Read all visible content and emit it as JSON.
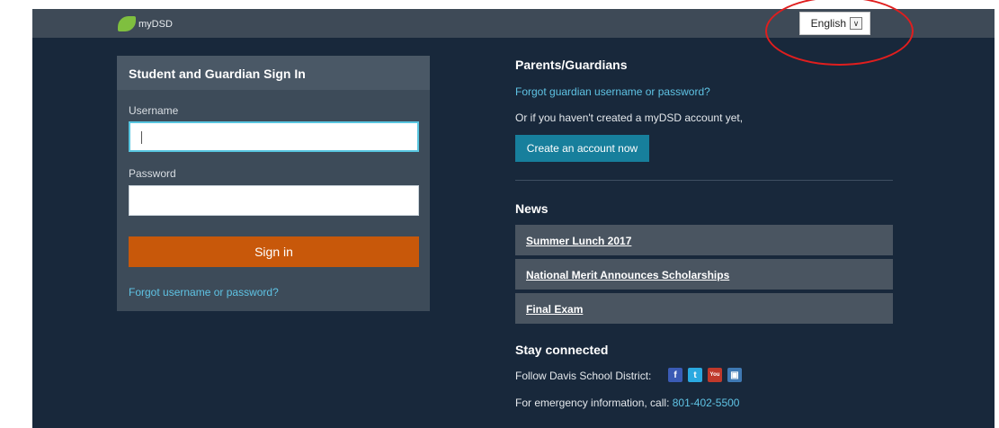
{
  "header": {
    "logo_text": "myDSD",
    "language": "English",
    "language_dropdown_icon": "chevron-down-icon"
  },
  "signin": {
    "title": "Student and Guardian Sign In",
    "username_label": "Username",
    "username_value": "",
    "password_label": "Password",
    "password_value": "",
    "button": "Sign in",
    "forgot": "Forgot username or password?"
  },
  "guardians": {
    "title": "Parents/Guardians",
    "forgot": "Forgot guardian username or password?",
    "prompt": "Or if you haven't created a myDSD account yet,",
    "button": "Create an account now"
  },
  "news": {
    "title": "News",
    "items": [
      "Summer Lunch 2017",
      "National Merit Announces Scholarships",
      "Final Exam"
    ]
  },
  "connect": {
    "title": "Stay connected",
    "follow": "Follow Davis School District:",
    "icons": [
      "facebook-icon",
      "twitter-icon",
      "youtube-icon",
      "instagram-icon"
    ],
    "emergency_prefix": "For emergency information, call:",
    "phone": "801-402-5500"
  },
  "colors": {
    "topbar": "#3e4a57",
    "background": "#18283b",
    "signin_button": "#c8580a",
    "create_button": "#177f9c",
    "link": "#5fc3e4",
    "annotation_circle": "#e01e1e"
  }
}
